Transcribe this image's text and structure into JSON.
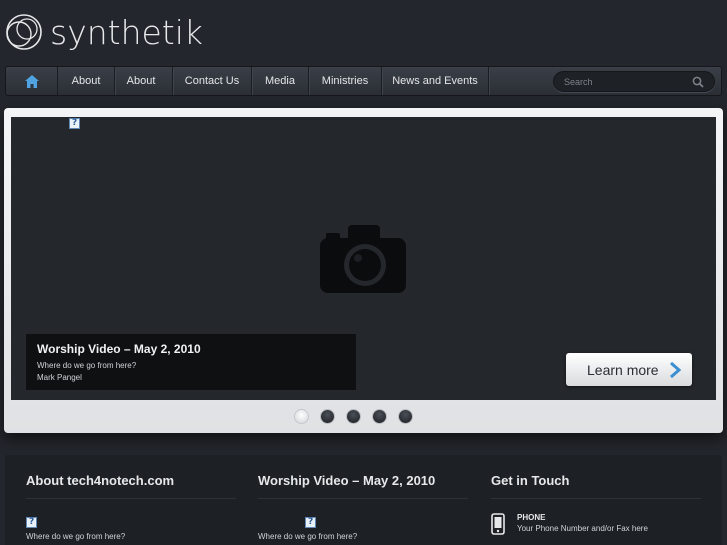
{
  "brand": {
    "name": "synthetik"
  },
  "nav": {
    "home_icon": "home-icon",
    "items": [
      {
        "label": "About"
      },
      {
        "label": "About",
        "has_dropdown": true
      },
      {
        "label": "Contact Us"
      },
      {
        "label": "Media"
      },
      {
        "label": "Ministries"
      },
      {
        "label": "News and Events"
      }
    ],
    "search": {
      "placeholder": "Search",
      "value": ""
    }
  },
  "slider": {
    "caption": {
      "title": "Worship Video – May 2, 2010",
      "line1": "Where do we go from here?",
      "line2": "Mark Pangel"
    },
    "learn_more_label": "Learn more",
    "dots": 5,
    "active_dot": 1
  },
  "footer": {
    "about": {
      "title": "About tech4notech.com",
      "text": "Where do we go from here?"
    },
    "worship": {
      "title": "Worship Video – May 2, 2010",
      "text": "Where do we go from here?"
    },
    "contact": {
      "title": "Get in Touch",
      "phone_label": "PHONE",
      "phone_value": "Your Phone Number and/or Fax here"
    }
  },
  "colors": {
    "background": "#23262c",
    "accent": "#3b8fd0"
  }
}
